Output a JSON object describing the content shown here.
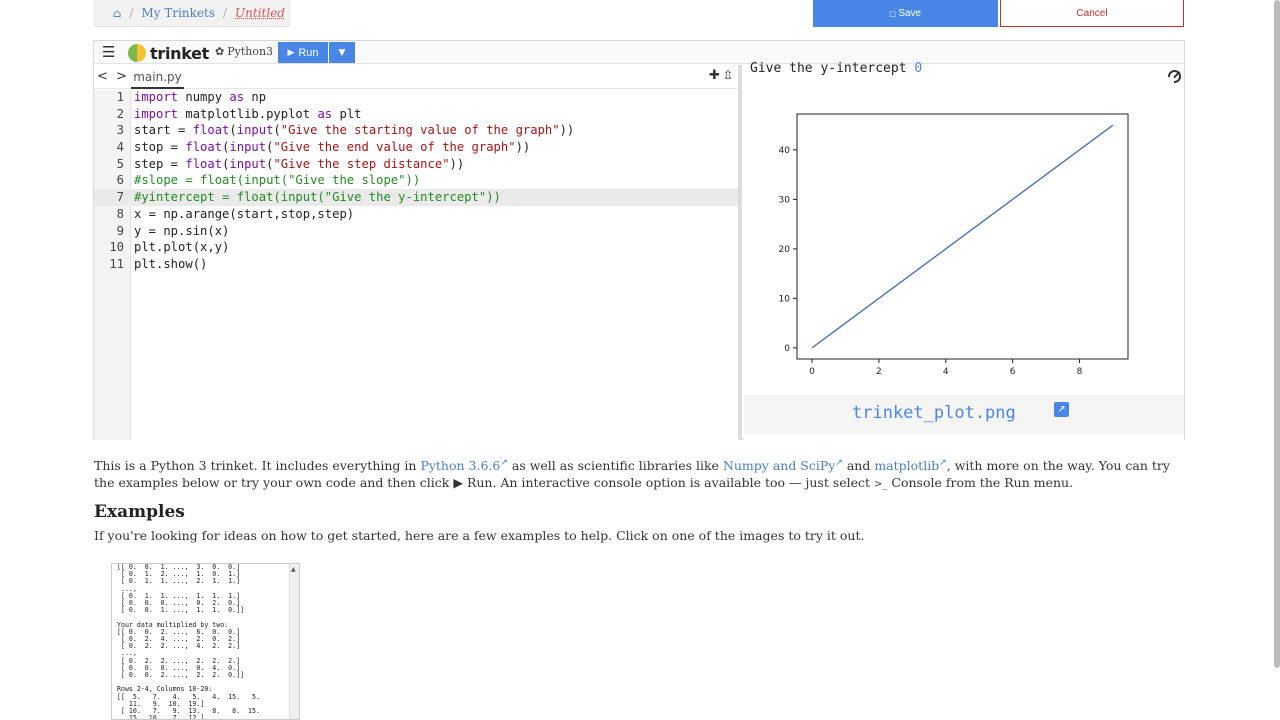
{
  "breadcrumb": {
    "home_icon": "home-icon",
    "parent": "My Trinkets",
    "current": "Untitled"
  },
  "actions": {
    "save_label": "Save",
    "save_icon": "floppy-disk-icon",
    "cancel_label": "Cancel"
  },
  "toolbar": {
    "logo_text": "trinket",
    "language": "Python3",
    "run_label": "Run"
  },
  "editor": {
    "file_tab": "main.py",
    "lines": [
      {
        "n": "1",
        "html": "<span style=\"color:#7a0fa8\">import</span> numpy <span style=\"color:#7a0fa8\">as</span> np"
      },
      {
        "n": "2",
        "html": "<span style=\"color:#7a0fa8\">import</span> matplotlib.pyplot <span style=\"color:#7a0fa8\">as</span> plt"
      },
      {
        "n": "3",
        "html": "start = <span style=\"color:#7a0fa8\">float</span>(<span style=\"color:#7a0fa8\">input</span>(<span style=\"color:#a31515\">\"Give the starting value of the graph\"</span>))"
      },
      {
        "n": "4",
        "html": "stop = <span style=\"color:#7a0fa8\">float</span>(<span style=\"color:#7a0fa8\">input</span>(<span style=\"color:#a31515\">\"Give the end value of the graph\"</span>))"
      },
      {
        "n": "5",
        "html": "step = <span style=\"color:#7a0fa8\">float</span>(<span style=\"color:#7a0fa8\">input</span>(<span style=\"color:#a31515\">\"Give the step distance\"</span>))"
      },
      {
        "n": "6",
        "html": "<span style=\"color:#228b22\">#slope = float(input(\"Give the slope\"))</span>"
      },
      {
        "n": "7",
        "html": "<span style=\"color:#228b22\">#yintercept = float(input(\"Give the y-intercept\"))</span>"
      },
      {
        "n": "8",
        "html": "x = np.arange(start,stop,step)"
      },
      {
        "n": "9",
        "html": "y = np.sin(x)"
      },
      {
        "n": "10",
        "html": "plt.plot(x,y)"
      },
      {
        "n": "11",
        "html": "plt.show()"
      }
    ]
  },
  "output": {
    "prompt": "Give the y-intercept ",
    "prompt_value": "0",
    "plot_filename": "trinket_plot.png"
  },
  "chart_data": {
    "type": "line",
    "x": [
      0,
      9
    ],
    "y": [
      0,
      45
    ],
    "xlim": [
      -0.45,
      9.45
    ],
    "ylim": [
      -2.25,
      47.25
    ],
    "xticks": [
      0,
      2,
      4,
      6,
      8
    ],
    "yticks": [
      0,
      10,
      20,
      30,
      40
    ],
    "color": "#4c72b0",
    "grid": false
  },
  "description": {
    "p1": "This is a Python 3 trinket. It includes everything in ",
    "link_python": "Python 3.6.6",
    "p2": " as well as scientific libraries like ",
    "link_numpy": "Numpy and SciPy",
    "p3": " and ",
    "link_mpl": "matplotlib",
    "p4": ", with more on the way. You can try the examples below or try your own code and then click ",
    "run_glyph": "▶",
    "p5": " Run. An interactive console option is available too — just select ",
    "console_glyph": ">_",
    "p6": " Console from the Run menu."
  },
  "examples": {
    "title": "Examples",
    "subtitle": "If you're looking for ideas on how to get started, here are a few examples to help. Click on one of the images to try it out.",
    "thumb_text": "[[ 0.  0.  1. ...,  3.  0.  0.]\n [ 0.  1.  2. ...,  1.  0.  1.]\n [ 0.  1.  1. ...,  2.  1.  1.]\n ...,\n [ 0.  1.  1. ...,  1.  1.  1.]\n [ 0.  0.  0. ...,  0.  2.  0.]\n [ 0.  0.  1. ...,  1.  1.  0.]]\n\nYour data multiplied by two:\n[[ 0.  0.  2. ...,  6.  0.  0.]\n [ 0.  2.  4. ...,  2.  0.  2.]\n [ 0.  2.  2. ...,  4.  2.  2.]\n ...,\n [ 0.  2.  2. ...,  2.  2.  2.]\n [ 0.  0.  0. ...,  0.  4.  0.]\n [ 0.  0.  2. ...,  2.  2.  0.]]\n\nRows 2-4, Columns 10-20:\n[[  5.   7.   4.   5.   4.  15.   5.\n   11.   9.  10.  19.]\n [ 10.   7.   9.  13.   8.   8.  15.\n   15.  10.   7.  12.]"
  }
}
